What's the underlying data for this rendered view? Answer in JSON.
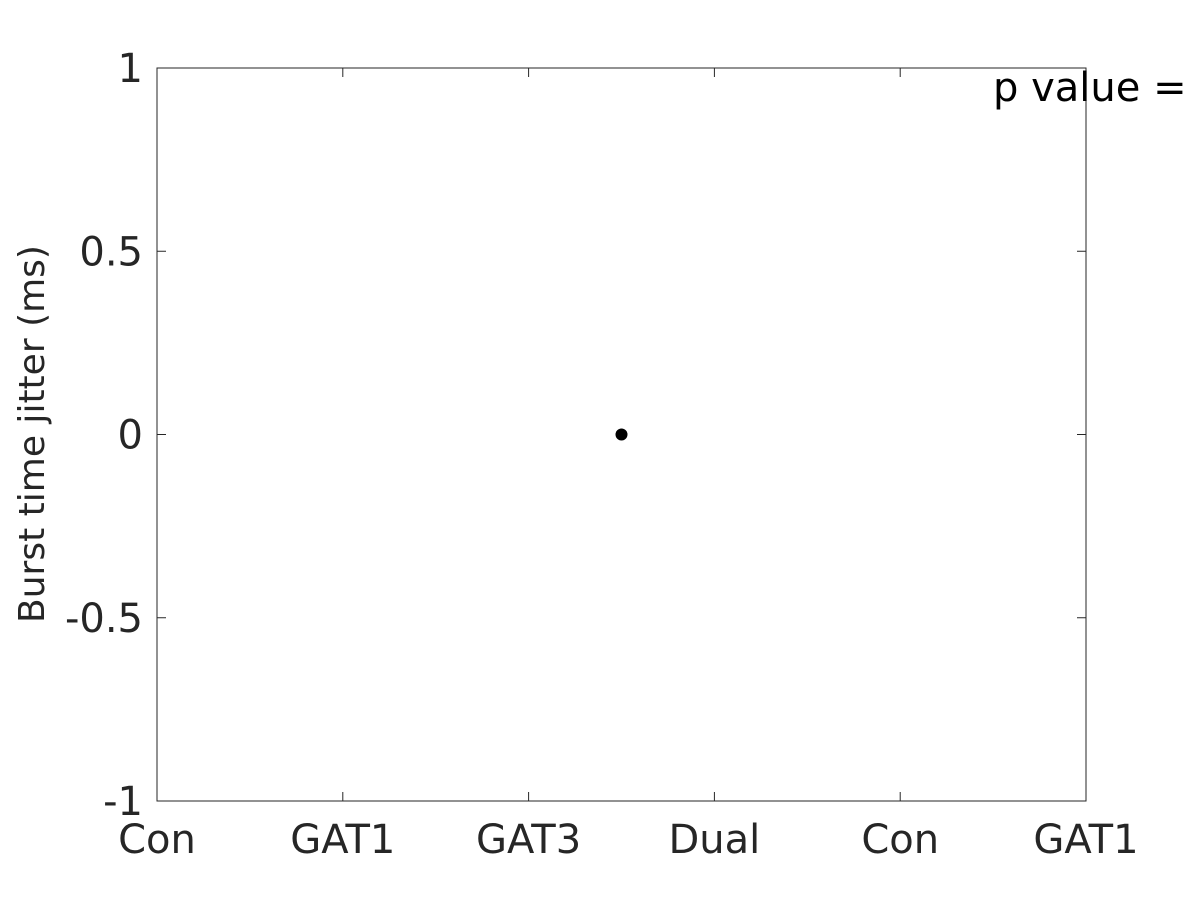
{
  "chart_data": {
    "type": "scatter",
    "title": "",
    "xlabel": "",
    "ylabel": "Burst time jitter (ms)",
    "x_tick_labels": [
      "Con",
      "GAT1",
      "GAT3",
      "Dual",
      "Con",
      "GAT1"
    ],
    "x_ticks": [
      0,
      1,
      2,
      3,
      4,
      5
    ],
    "xlim": [
      0,
      5
    ],
    "y_tick_labels": [
      "1",
      "0.5",
      "0",
      "-0.5",
      "-1"
    ],
    "y_ticks": [
      1,
      0.5,
      0,
      -0.5,
      -1
    ],
    "ylim": [
      -1,
      1
    ],
    "grid": false,
    "points": [
      {
        "x": 2.5,
        "y": 0
      }
    ],
    "annotation": "p value =",
    "colors": {
      "point": "#000000",
      "axis": "#262626",
      "annotation": "#000000"
    }
  }
}
